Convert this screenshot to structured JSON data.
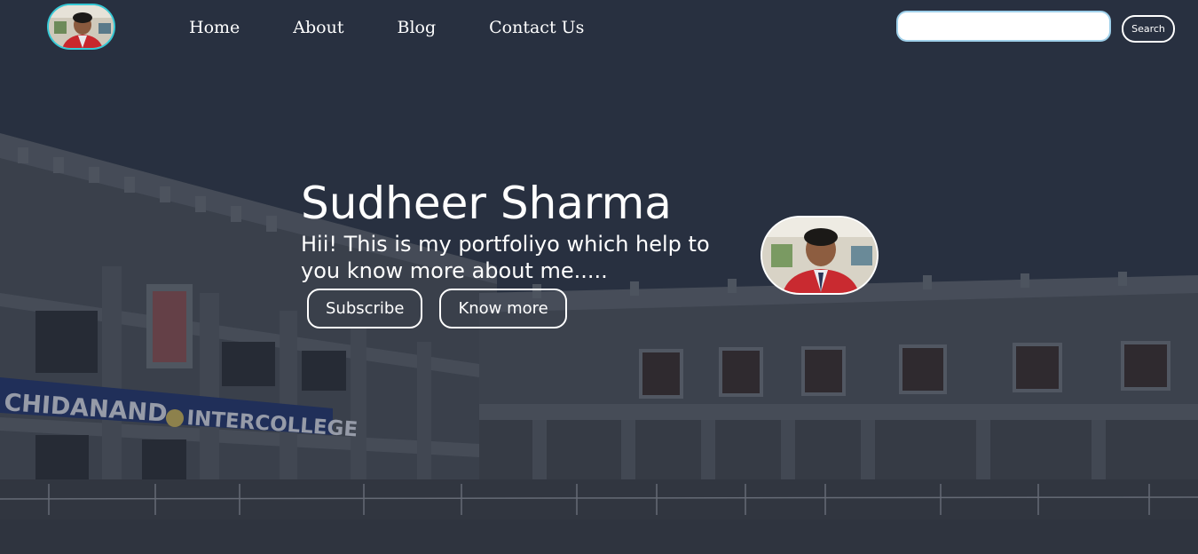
{
  "nav": {
    "links": [
      "Home",
      "About",
      "Blog",
      "Contact Us"
    ],
    "search_placeholder": "",
    "search_button": "Search"
  },
  "hero": {
    "title": "Sudheer Sharma",
    "subtitle": "Hii! This is my portfoliyo which help to you know more about me.....",
    "buttons": [
      "Subscribe",
      "Know more"
    ]
  },
  "background": {
    "sign_text": "CHIDANAND",
    "sign_text_2": "INTERCOLLEGE"
  },
  "colors": {
    "overlay": "#2d3646",
    "accent_border": "#36c9d6",
    "search_border": "#9fd0ea",
    "sign_blue": "#23356e"
  }
}
